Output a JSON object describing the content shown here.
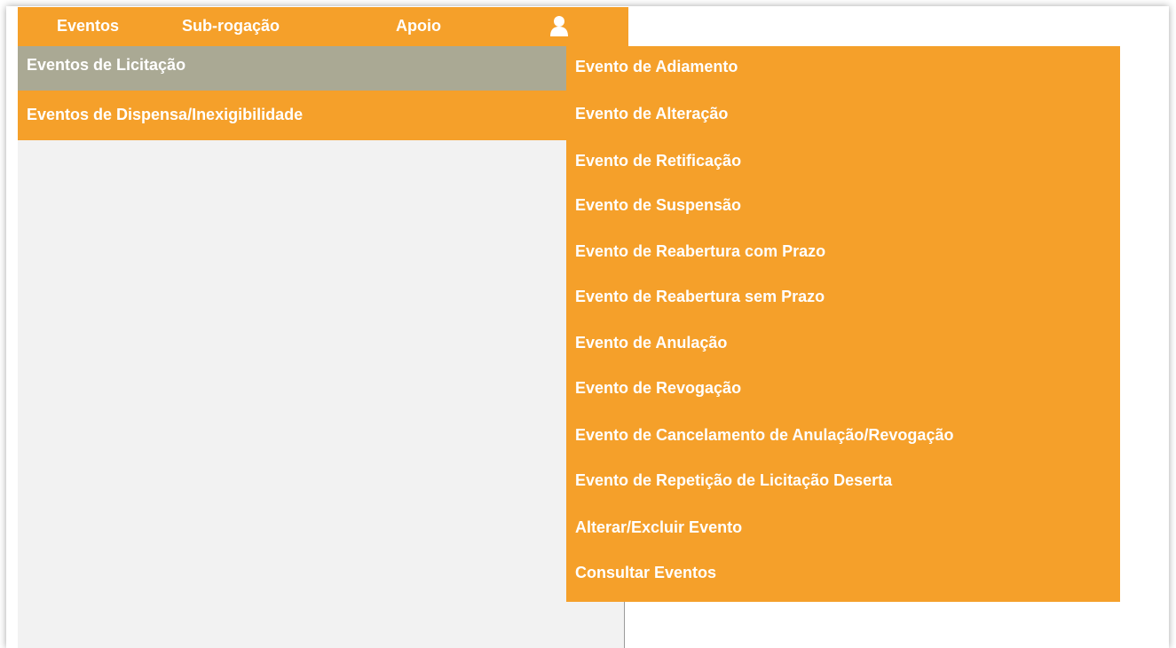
{
  "colors": {
    "accent": "#f5a02a",
    "active_item": "#aaa994",
    "panel": "#f2f2f2",
    "text": "#ffffff"
  },
  "topbar": {
    "items": [
      {
        "label": "Eventos"
      },
      {
        "label": "Sub-rogação"
      },
      {
        "label": "Apoio"
      }
    ],
    "user_icon": "user-icon"
  },
  "submenu": {
    "items": [
      {
        "label": "Eventos de Licitação",
        "active": true
      },
      {
        "label": "Eventos de Dispensa/Inexigibilidade",
        "active": false
      }
    ]
  },
  "flyout": {
    "items": [
      {
        "label": "Evento de Adiamento"
      },
      {
        "label": "Evento de Alteração"
      },
      {
        "label": "Evento de Retificação"
      },
      {
        "label": "Evento de Suspensão"
      },
      {
        "label": "Evento de Reabertura com Prazo"
      },
      {
        "label": "Evento de Reabertura sem Prazo"
      },
      {
        "label": "Evento de Anulação"
      },
      {
        "label": "Evento de Revogação"
      },
      {
        "label": "Evento de Cancelamento de Anulação/Revogação"
      },
      {
        "label": "Evento de Repetição de Licitação Deserta"
      },
      {
        "label": "Alterar/Excluir Evento"
      },
      {
        "label": "Consultar Eventos"
      }
    ]
  }
}
